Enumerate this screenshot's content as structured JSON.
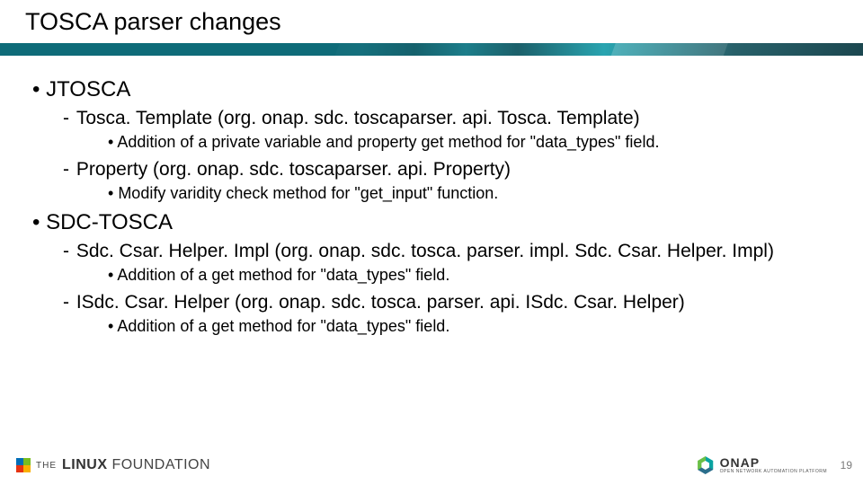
{
  "title": "TOSCA parser changes",
  "bullets": {
    "jtosca": {
      "label": "JTOSCA",
      "tosca_template": {
        "label": "Tosca. Template (org. onap. sdc. toscaparser. api. Tosca. Template)",
        "detail": "Addition of a private variable and property get method for \"data_types\" field."
      },
      "property": {
        "label": "Property (org. onap. sdc. toscaparser. api. Property)",
        "detail": "Modify varidity check method for \"get_input\" function."
      }
    },
    "sdc_tosca": {
      "label": "SDC-TOSCA",
      "sdc_csar_helper_impl": {
        "label": "Sdc. Csar. Helper. Impl (org. onap. sdc. tosca. parser. impl. Sdc. Csar. Helper. Impl)",
        "detail": "Addition of a get method for \"data_types\" field."
      },
      "isdc_csar_helper": {
        "label": "ISdc. Csar. Helper (org. onap. sdc. tosca. parser. api. ISdc. Csar. Helper)",
        "detail": "Addition of a get method for \"data_types\" field."
      }
    }
  },
  "footer": {
    "lf_the": "THE",
    "lf_linux": "LINUX",
    "lf_foundation": "FOUNDATION",
    "onap_name": "ONAP",
    "onap_tag": "OPEN NETWORK AUTOMATION PLATFORM",
    "page": "19"
  }
}
